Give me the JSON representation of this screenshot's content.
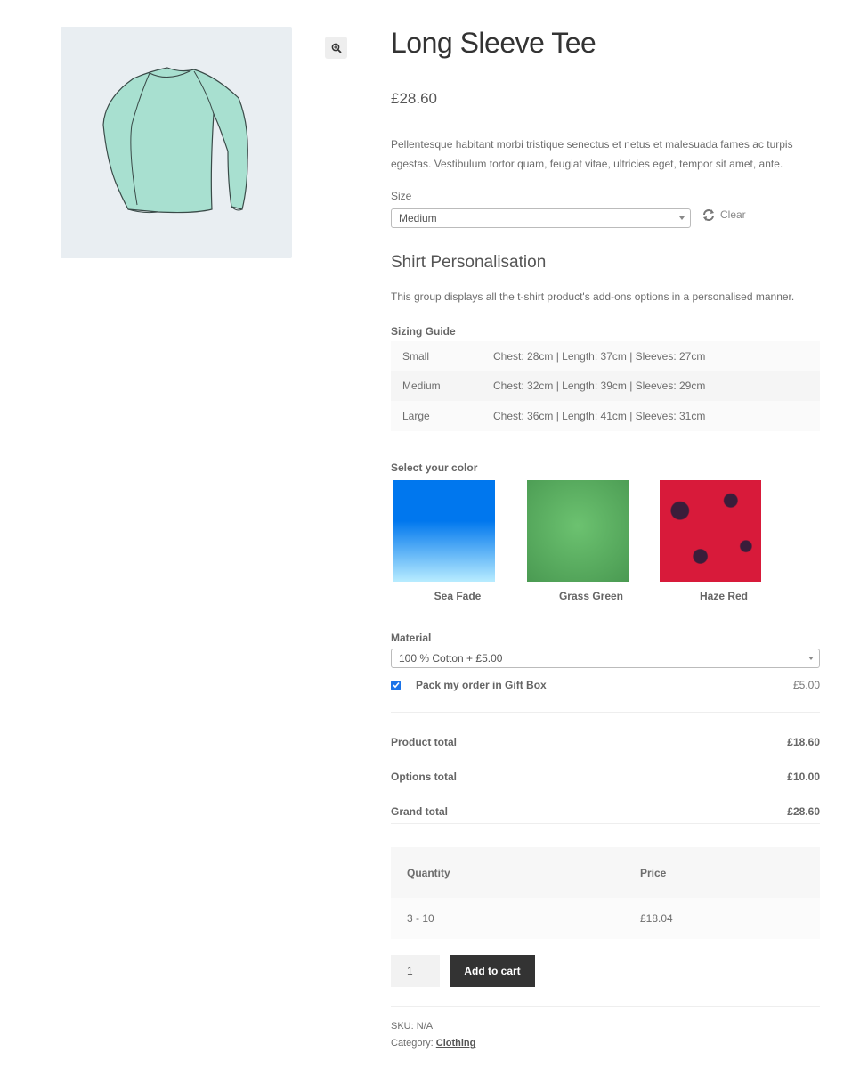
{
  "product": {
    "title": "Long Sleeve Tee",
    "price": "£28.60",
    "description": "Pellentesque habitant morbi tristique senectus et netus et malesuada fames ac turpis egestas. Vestibulum tortor quam, feugiat vitae, ultricies eget, tempor sit amet, ante.",
    "image_icon": "long-sleeve-shirt-image",
    "zoom_icon": "zoom-in-icon"
  },
  "variation": {
    "size_label": "Size",
    "size_value": "Medium",
    "clear_label": "Clear",
    "clear_icon": "refresh-icon"
  },
  "addons": {
    "group_title": "Shirt Personalisation",
    "group_description": "This group displays all the t-shirt product's add-ons options in a personalised manner.",
    "sizing_guide": {
      "label": "Sizing Guide",
      "rows": [
        {
          "size": "Small",
          "details": "Chest: 28cm | Length: 37cm | Sleeves: 27cm"
        },
        {
          "size": "Medium",
          "details": "Chest: 32cm | Length: 39cm | Sleeves: 29cm"
        },
        {
          "size": "Large",
          "details": "Chest: 36cm | Length: 41cm | Sleeves: 31cm"
        }
      ]
    },
    "color": {
      "label": "Select your color",
      "options": [
        {
          "name": "Sea Fade",
          "color_top": "#0077ee",
          "color_bottom": "#b8ecff"
        },
        {
          "name": "Grass Green",
          "color_top": "#4a9a52",
          "color_bottom": "#6cc270"
        },
        {
          "name": "Haze Red",
          "color_top": "#d81a3a",
          "color_bottom": "#3a1d3a"
        }
      ]
    },
    "material": {
      "label": "Material",
      "value": "100 % Cotton + £5.00"
    },
    "giftbox": {
      "label": "Pack my order in Gift Box",
      "price": "£5.00",
      "checked": true
    }
  },
  "totals": {
    "product_label": "Product total",
    "product_value": "£18.60",
    "options_label": "Options total",
    "options_value": "£10.00",
    "grand_label": "Grand total",
    "grand_value": "£28.60"
  },
  "bulk_pricing": {
    "headers": [
      "Quantity",
      "Price"
    ],
    "rows": [
      {
        "quantity": "3 - 10",
        "price": "£18.04"
      }
    ]
  },
  "cart": {
    "quantity": "1",
    "add_to_cart_label": "Add to cart"
  },
  "meta": {
    "sku_label": "SKU:",
    "sku_value": "N/A",
    "category_label": "Category:",
    "category_value": "Clothing"
  }
}
